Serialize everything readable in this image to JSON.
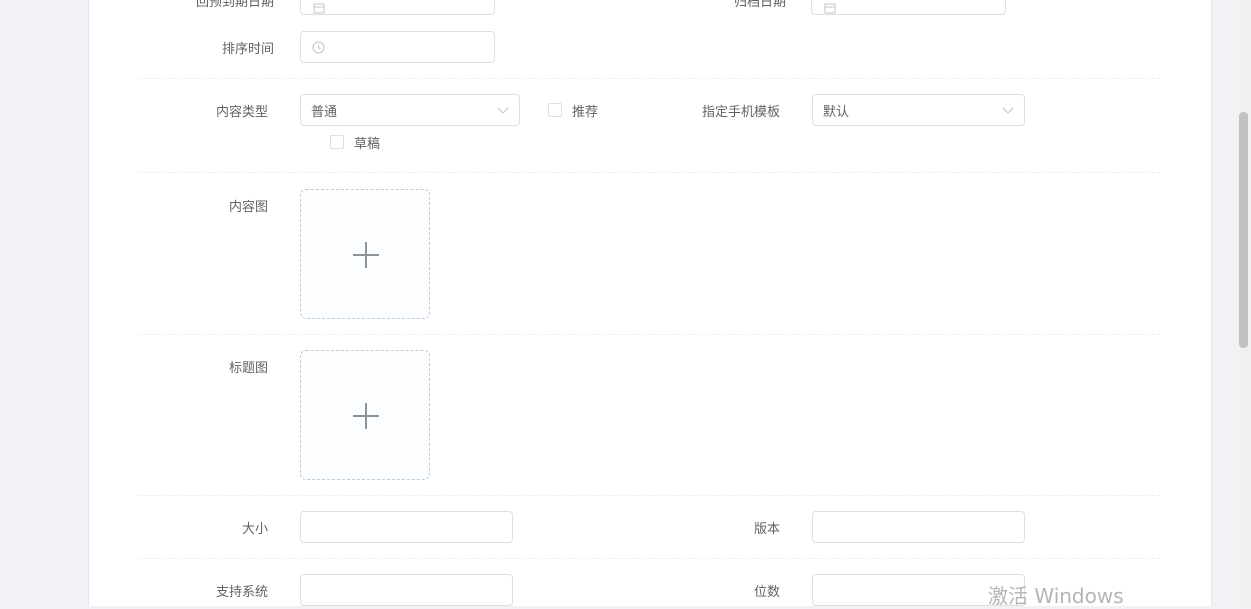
{
  "form": {
    "row_top": {
      "left_label": "回预到期日期",
      "right_label": "归档日期"
    },
    "sort_time": {
      "label": "排序时间",
      "value": ""
    },
    "content_type": {
      "label": "内容类型",
      "selected": "普通",
      "recommend_label": "推荐",
      "draft_label": "草稿",
      "mobile_template_label": "指定手机模板",
      "mobile_template_selected": "默认"
    },
    "content_image": {
      "label": "内容图"
    },
    "title_image": {
      "label": "标题图"
    },
    "size": {
      "label": "大小",
      "value": ""
    },
    "version": {
      "label": "版本",
      "value": ""
    },
    "support_system": {
      "label": "支持系统",
      "value": ""
    },
    "bits": {
      "label": "位数",
      "value": ""
    }
  },
  "watermark": "激活 Windows",
  "colors": {
    "border": "#dcdfe6",
    "text": "#606266",
    "upload_plus": "#8c939d"
  },
  "icons": [
    "calendar-icon",
    "clock-icon",
    "chevron-down-icon",
    "plus-icon"
  ]
}
